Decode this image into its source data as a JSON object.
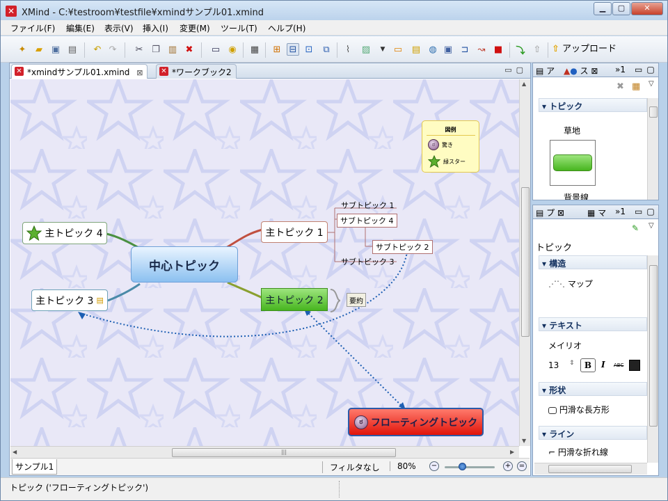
{
  "window": {
    "title": "XMind - C:¥testroom¥testfile¥xmindサンプル01.xmind",
    "app_icon": "✕"
  },
  "menu": [
    "ファイル(F)",
    "編集(E)",
    "表示(V)",
    "挿入(I)",
    "変更(M)",
    "ツール(T)",
    "ヘルプ(H)"
  ],
  "toolbar": {
    "upload_label": "アップロード"
  },
  "editor": {
    "tabs": [
      {
        "label": "*xmindサンプル01.xmind",
        "close": "⊠"
      },
      {
        "label": "*ワークブック2"
      }
    ],
    "sheet_tab": "サンプル1",
    "filter_label": "フィルタなし",
    "zoom": "80%"
  },
  "mindmap": {
    "central": "中心トピック",
    "main1": "主トピック 1",
    "main2": "主トピック 2",
    "main3": "主トピック 3",
    "main4": "主トピック 4",
    "sub1": "サブトピック 1",
    "sub4": "サブトピック 4",
    "sub2": "サブトピック 2",
    "sub3": "サブトピック 3",
    "summary": "要約",
    "floating": "フローティングトピック",
    "legend": {
      "title": "図例",
      "item1": "驚き",
      "item2": "緑スター"
    }
  },
  "panel_top": {
    "tabs": [
      "ア",
      "ス",
      "»1"
    ],
    "section": "トピック",
    "item_label": "草地",
    "cut_label": "背景線"
  },
  "panel_bottom": {
    "tabs": [
      "プ",
      "マ",
      "»1"
    ],
    "heading": "トピック",
    "structure_header": "構造",
    "structure_value": "マップ",
    "text_header": "テキスト",
    "font_name": "メイリオ",
    "font_size": "13",
    "bold": "B",
    "italic": "I",
    "strike": "ABC",
    "shape_header": "形状",
    "shape_value": "円滑な長方形",
    "line_header": "ライン",
    "line_value": "円滑な折れ線"
  },
  "status": {
    "text": "トピック ('フローティングトピック')"
  },
  "colors": {
    "accent": "#2c5aa8",
    "floating": "#e0140a",
    "main2": "#47b51f",
    "central": "#8bc0f0",
    "canvas": "#e9e8f7"
  }
}
